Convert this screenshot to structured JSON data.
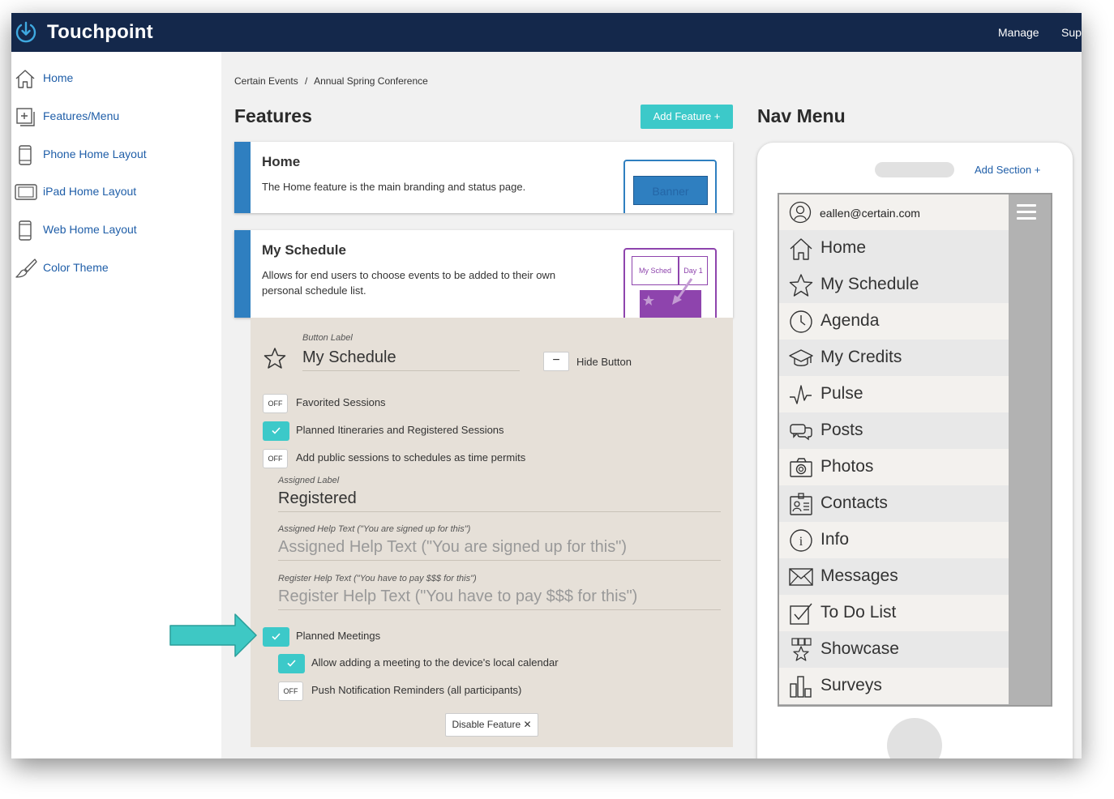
{
  "app": {
    "name": "Touchpoint",
    "top_links": [
      "Manage",
      "Sup"
    ]
  },
  "sidebar": {
    "items": [
      {
        "label": "Home",
        "icon": "home-icon"
      },
      {
        "label": "Features/Menu",
        "icon": "plus-box-icon"
      },
      {
        "label": "Phone Home Layout",
        "icon": "phone-icon"
      },
      {
        "label": "iPad Home Layout",
        "icon": "tablet-icon"
      },
      {
        "label": "Web Home Layout",
        "icon": "phone-icon"
      },
      {
        "label": "Color Theme",
        "icon": "paintbrush-icon"
      }
    ]
  },
  "breadcrumb": {
    "parent": "Certain Events",
    "separator": "/",
    "current": "Annual Spring Conference"
  },
  "features": {
    "title": "Features",
    "add_button": "Add Feature +",
    "cards": [
      {
        "title": "Home",
        "description": "The Home feature is the main branding and status page.",
        "preview_text": "Banner"
      },
      {
        "title": "My Schedule",
        "description": "Allows for end users to choose events to be added to their own personal schedule list.",
        "preview_tabs": [
          "My Sched",
          "Day 1"
        ]
      }
    ]
  },
  "schedule_panel": {
    "button_label_caption": "Button Label",
    "button_label_value": "My Schedule",
    "hide_button": "Hide Button",
    "off_text": "OFF",
    "options": [
      {
        "label": "Favorited Sessions",
        "state": "off"
      },
      {
        "label": "Planned Itineraries and Registered Sessions",
        "state": "on"
      },
      {
        "label": "Add public sessions to schedules as time permits",
        "state": "off"
      }
    ],
    "assigned_label_caption": "Assigned Label",
    "assigned_label_value": "Registered",
    "assigned_help_caption": "Assigned Help Text (\"You are signed up for this\")",
    "assigned_help_placeholder": "Assigned Help Text (\"You are signed up for this\")",
    "register_help_caption": "Register Help Text (\"You have to pay $$$ for this\")",
    "register_help_placeholder": "Register Help Text (\"You have to pay $$$ for this\")",
    "meeting_options": [
      {
        "label": "Planned Meetings",
        "state": "on"
      },
      {
        "label": "Allow adding a meeting to the device's local calendar",
        "state": "on"
      },
      {
        "label": "Push Notification Reminders (all participants)",
        "state": "off"
      }
    ],
    "disable_button": "Disable Feature ✕"
  },
  "nav_menu": {
    "title": "Nav Menu",
    "add_section": "Add Section +",
    "user_email": "eallen@certain.com",
    "items": [
      {
        "label": "Home",
        "icon": "home-icon"
      },
      {
        "label": "My Schedule",
        "icon": "star-icon"
      },
      {
        "label": "Agenda",
        "icon": "clock-icon"
      },
      {
        "label": "My Credits",
        "icon": "graduation-cap-icon"
      },
      {
        "label": "Pulse",
        "icon": "pulse-icon"
      },
      {
        "label": "Posts",
        "icon": "chat-bubbles-icon"
      },
      {
        "label": "Photos",
        "icon": "camera-icon"
      },
      {
        "label": "Contacts",
        "icon": "id-card-icon"
      },
      {
        "label": "Info",
        "icon": "info-icon"
      },
      {
        "label": "Messages",
        "icon": "envelope-icon"
      },
      {
        "label": "To Do List",
        "icon": "checkbox-icon"
      },
      {
        "label": "Showcase",
        "icon": "showcase-star-icon"
      },
      {
        "label": "Surveys",
        "icon": "bar-chart-icon"
      }
    ]
  },
  "colors": {
    "topbar": "#14284b",
    "accent": "#3cc9c9",
    "card_stripe": "#2f7fc0",
    "link": "#1f5ea8",
    "panel_bg": "#e6e0d8"
  }
}
